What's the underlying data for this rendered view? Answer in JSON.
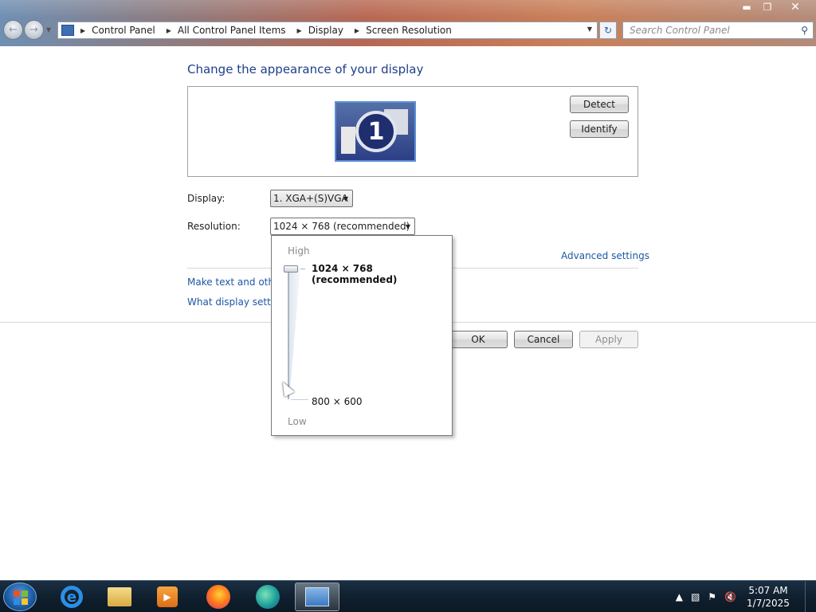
{
  "window": {
    "minimize_icon": "minimize-icon",
    "maximize_icon": "restore-icon",
    "close_icon": "close-icon"
  },
  "nav": {
    "breadcrumbs": [
      "Control Panel",
      "All Control Panel Items",
      "Display",
      "Screen Resolution"
    ],
    "search_placeholder": "Search Control Panel"
  },
  "page": {
    "heading": "Change the appearance of your display",
    "monitor_number": "1",
    "detect_label": "Detect",
    "identify_label": "Identify",
    "display_label": "Display:",
    "display_value": "1. XGA+(S)VGA",
    "resolution_label": "Resolution:",
    "resolution_value": "1024 × 768 (recommended)",
    "advanced_link": "Advanced settings",
    "link_text_size": "Make text and other",
    "link_display_settings": "What display setting",
    "ok_label": "OK",
    "cancel_label": "Cancel",
    "apply_label": "Apply"
  },
  "resolution_popup": {
    "high_label": "High",
    "low_label": "Low",
    "options": [
      "1024 × 768 (recommended)",
      "800 × 600"
    ],
    "selected_index": 0
  },
  "taskbar": {
    "apps": [
      "internet-explorer",
      "file-explorer",
      "media-player",
      "firefox",
      "edge",
      "control-panel"
    ],
    "time": "5:07 AM",
    "date": "1/7/2025"
  },
  "colors": {
    "heading": "#1e3f8a",
    "link": "#1c57a5",
    "taskbar": "#10202f"
  }
}
